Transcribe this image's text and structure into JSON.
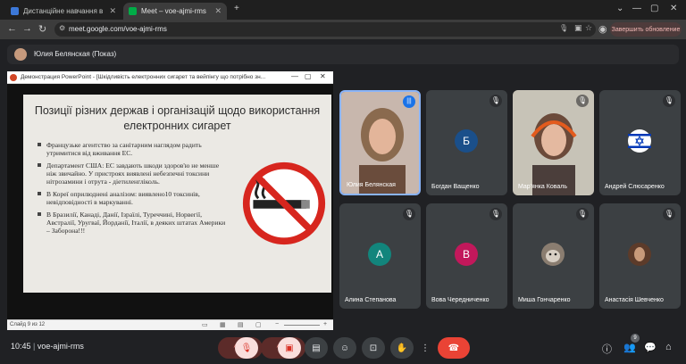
{
  "browser": {
    "tabs": [
      {
        "label": "Дистанційне навчання в ВСП",
        "favicon_color": "#3c78d8",
        "active": false
      },
      {
        "label": "Meet – voe-ajmi-rms",
        "favicon_color": "#00ac47",
        "active": true
      }
    ],
    "new_tab": "+",
    "window_controls": [
      "⌄",
      "—",
      "▢",
      "✕"
    ],
    "nav": {
      "back": "←",
      "forward": "→",
      "reload": "↻"
    },
    "url": "meet.google.com/voe-ajmi-rms",
    "update_button": "Завершить обновление"
  },
  "presenter_bar": {
    "name": "Юлия Белянская (Показ)"
  },
  "presentation": {
    "window_title": "Демонстрация PowerPoint - [Шкідливість електронних сигарет та вейпінгу що потрібно зн...",
    "window_controls": [
      "—",
      "▢",
      "✕"
    ],
    "slide_title": "Позиції різних держав і організацій щодо використання електронних сигарет",
    "bullets": [
      "Французьке агентство за санітарним наглядом радить утримитися від вживання ЕС.",
      "Департамент США: ЕС завдають шкоди здоров'ю не менше ніж звичайно. У пристроях виявлені небезпечні токсини нітрозамини і отрута - діетиленгліколь.",
      "В Кореї оприлюднені аналізом: виявлено10 токсинів, невідповідності в маркуванні.",
      "В Бразилії, Канаді, Данії, Ізраїлі, Туреччині, Норвегії, Австралії, Уругваї, Йорданії, Італії, в деяких штатах Америки – Заборона!!!"
    ],
    "status_text": "Слайд 9 из 12"
  },
  "participants": [
    {
      "name": "Юлия Белянская",
      "type": "video",
      "speaking": true
    },
    {
      "name": "Богдан Ващенко",
      "type": "avatar",
      "initial": "Б",
      "color": "#1a4f8a"
    },
    {
      "name": "Мар'янка Коваль",
      "type": "video"
    },
    {
      "name": "Андрей Слюсаренко",
      "type": "flag"
    },
    {
      "name": "Алина Степанова",
      "type": "avatar",
      "initial": "А",
      "color": "#12857c"
    },
    {
      "name": "Вова Чередниченко",
      "type": "avatar",
      "initial": "В",
      "color": "#c2185b"
    },
    {
      "name": "Миша Гончаренко",
      "type": "photo"
    },
    {
      "name": "Анастасія Шевченко",
      "type": "photo"
    }
  ],
  "bottom": {
    "time": "10:45",
    "meeting_code": "voe-ajmi-rms",
    "people_count": "9"
  },
  "colors": {
    "hangup": "#ea4335",
    "muted_bg": "#5c2b29",
    "accent": "#8ab4f8"
  }
}
